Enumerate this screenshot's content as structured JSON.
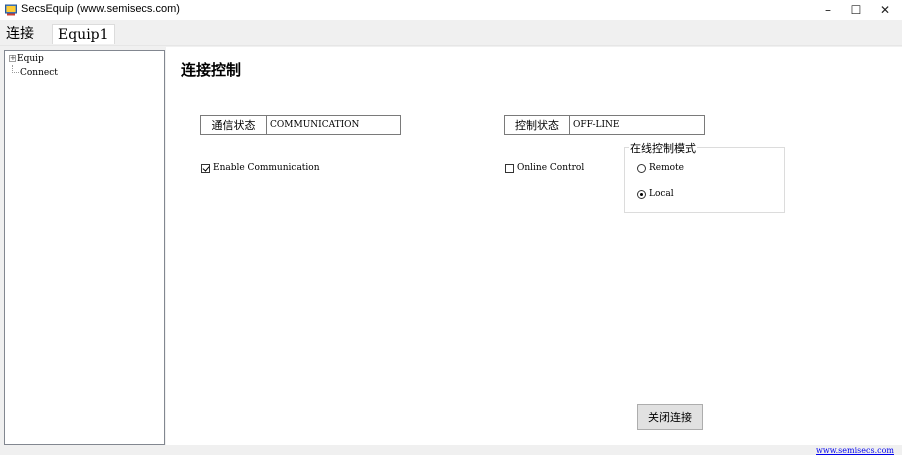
{
  "window": {
    "title": "SecsEquip  (www.semisecs.com)",
    "icon": "app-window-icon",
    "minimize_symbol": "–",
    "maximize_symbol": "☐",
    "close_symbol": "✕"
  },
  "menu": {
    "items": [
      {
        "label": "连接"
      },
      {
        "label": "Equip1"
      }
    ]
  },
  "tree": {
    "nodes": [
      {
        "label": "Equip",
        "expander": "⊞"
      },
      {
        "label": "Connect"
      }
    ]
  },
  "main": {
    "title": "连接控制",
    "communication": {
      "label": "通信状态",
      "value": "COMMUNICATION"
    },
    "control": {
      "label": "控制状态",
      "value": "OFF-LINE"
    },
    "enable_communication": {
      "label": "Enable Communication",
      "checked": true
    },
    "online_control": {
      "label": "Online Control",
      "checked": false
    },
    "online_mode_group": {
      "legend": "在线控制模式",
      "options": [
        {
          "label": "Remote",
          "selected": false
        },
        {
          "label": "Local",
          "selected": true
        }
      ]
    },
    "close_button_label": "关闭连接"
  },
  "footer": {
    "link": "www.semisecs.com"
  },
  "colors": {
    "link": "#0000ee",
    "window_bg": "#f0f0f0",
    "content_bg": "#ffffff"
  }
}
